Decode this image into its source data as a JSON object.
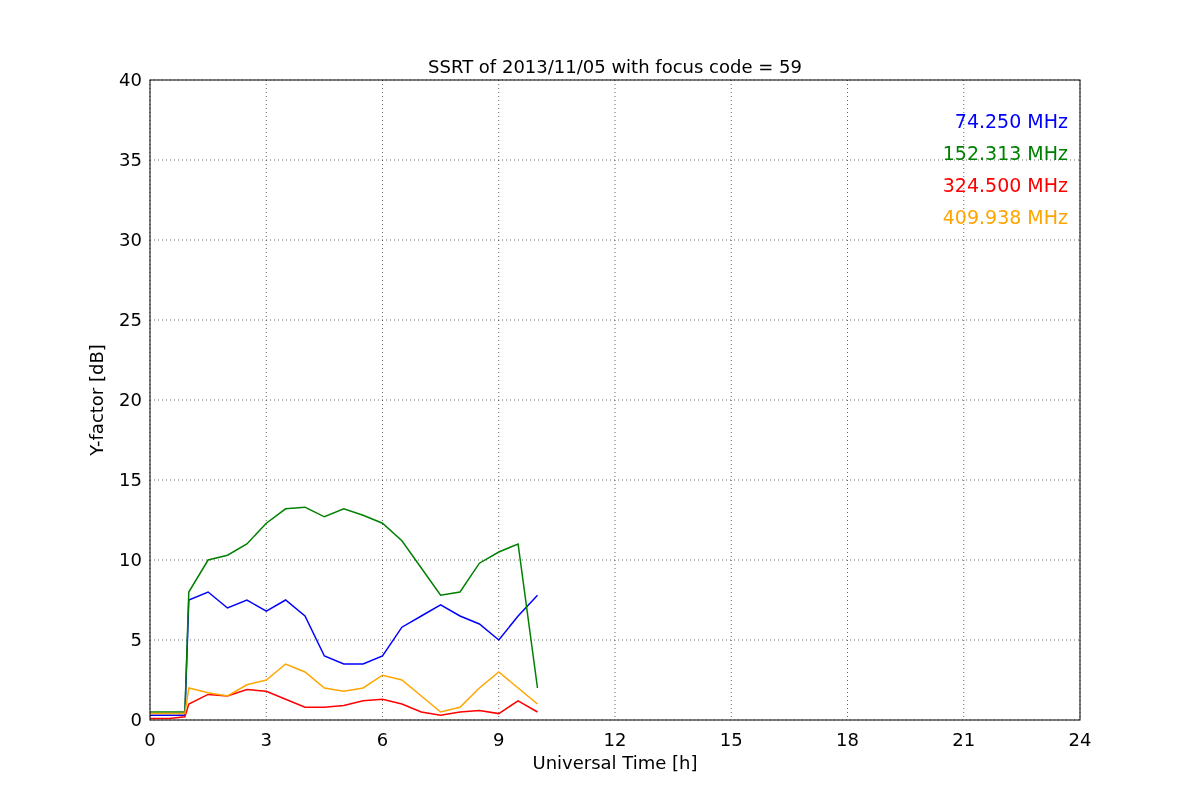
{
  "chart_data": {
    "type": "line",
    "title": "SSRT of 2013/11/05 with focus code = 59",
    "xlabel": "Universal Time [h]",
    "ylabel": "Y-factor [dB]",
    "x": [
      0,
      0.5,
      0.9,
      1,
      1.5,
      2,
      2.5,
      3,
      3.5,
      4,
      4.5,
      5,
      5.5,
      6,
      6.5,
      7,
      7.5,
      8,
      8.5,
      9,
      9.5,
      10
    ],
    "series": [
      {
        "name": "74.250 MHz",
        "color": "#0000ff",
        "values": [
          0.3,
          0.3,
          0.3,
          7.5,
          8,
          7,
          7.5,
          6.8,
          7.5,
          6.5,
          4,
          3.5,
          3.5,
          4,
          5.8,
          6.5,
          7.2,
          6.5,
          6,
          5,
          6.5,
          7.8
        ]
      },
      {
        "name": "152.313 MHz",
        "color": "#008000",
        "values": [
          0.5,
          0.5,
          0.5,
          8,
          10,
          10.3,
          11,
          12.3,
          13.2,
          13.3,
          12.7,
          13.2,
          12.8,
          12.3,
          11.2,
          9.5,
          7.8,
          8,
          9.8,
          10.5,
          11,
          2
        ]
      },
      {
        "name": "324.500 MHz",
        "color": "#ff0000",
        "values": [
          0.1,
          0.1,
          0.2,
          1,
          1.6,
          1.5,
          1.9,
          1.8,
          1.3,
          0.8,
          0.8,
          0.9,
          1.2,
          1.3,
          1,
          0.5,
          0.3,
          0.5,
          0.6,
          0.4,
          1.2,
          0.5
        ]
      },
      {
        "name": "409.938 MHz",
        "color": "#ffa500",
        "values": [
          0.4,
          0.4,
          0.4,
          2,
          1.7,
          1.5,
          2.2,
          2.5,
          3.5,
          3,
          2,
          1.8,
          2,
          2.8,
          2.5,
          1.5,
          0.5,
          0.8,
          2,
          3,
          2,
          1
        ]
      }
    ],
    "grid": true,
    "xlim": [
      0,
      24
    ],
    "ylim": [
      0,
      40
    ],
    "xticks": [
      0,
      3,
      6,
      9,
      12,
      15,
      18,
      21,
      24
    ],
    "yticks": [
      0,
      5,
      10,
      15,
      20,
      25,
      30,
      35,
      40
    ]
  }
}
